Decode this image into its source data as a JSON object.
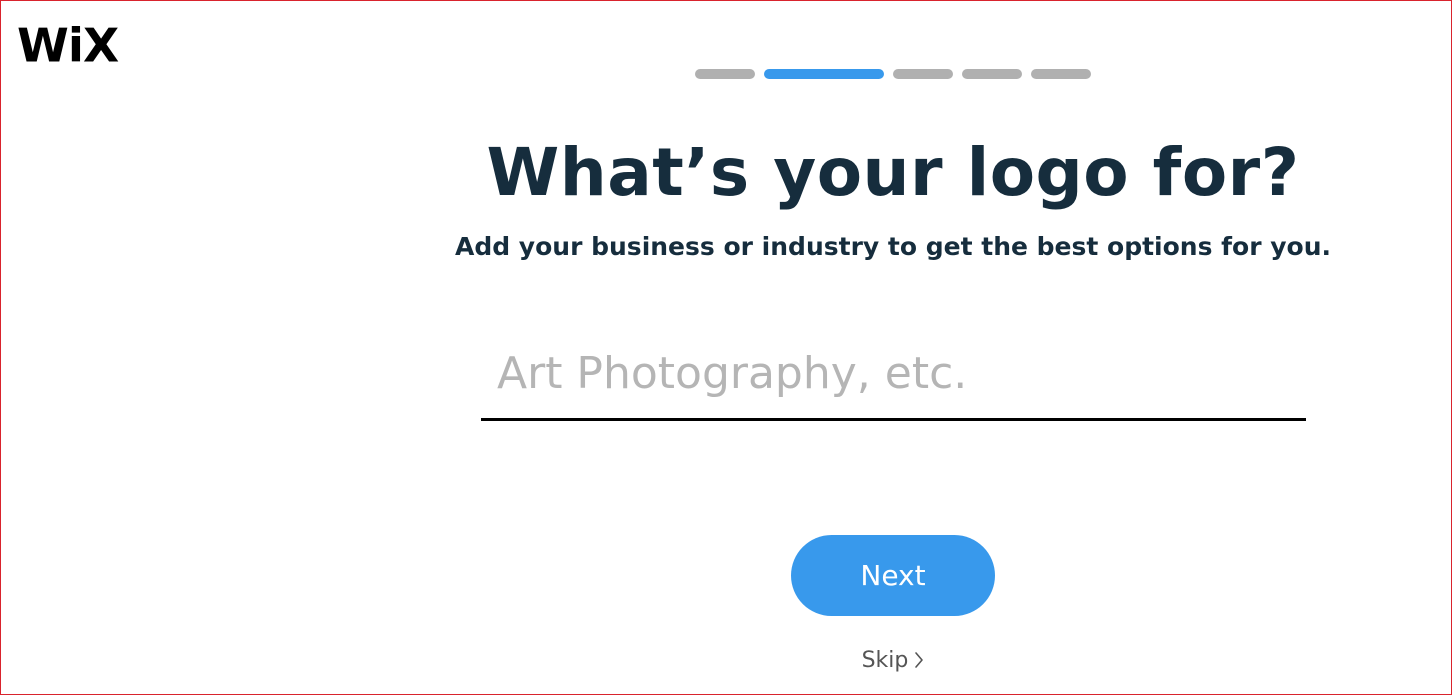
{
  "brand": {
    "logo_text": "WiX"
  },
  "progress": {
    "steps": 5,
    "current_step": 2,
    "active_color": "#3899ec",
    "inactive_color": "#b0b0b0"
  },
  "main": {
    "title": "What’s your logo for?",
    "subtitle": "Add your business or industry to get the best options for you."
  },
  "business_input": {
    "value": "",
    "placeholder": "Art Photography, etc."
  },
  "actions": {
    "next_label": "Next",
    "skip_label": "Skip",
    "skip_icon": "chevron-right-icon",
    "primary_color": "#3899ec"
  },
  "colors": {
    "heading": "#162d3d",
    "frame_border": "#d9232d"
  }
}
